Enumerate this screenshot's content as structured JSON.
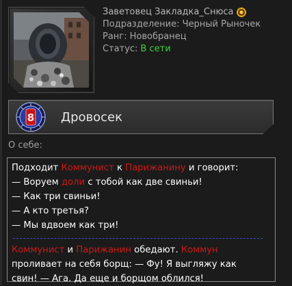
{
  "profile": {
    "name": "Заветовец Закладка_Снюса",
    "division_label": "Подразделение:",
    "division_value": "Черный Рыночек",
    "rank_label": "Ранг:",
    "rank_value": "Новобранец",
    "status_label": "Статус:",
    "status_value": "В сети",
    "status_color": "#3bd13b"
  },
  "rank_bar": {
    "title": "Дровосек",
    "emblem_number": "8"
  },
  "about": {
    "label": "О себе:",
    "joke1": {
      "l1": [
        "Подходит ",
        "Коммунист",
        " к ",
        "Парижанину",
        " и говорит:"
      ],
      "l2": [
        "— Воруем ",
        "доли",
        " с тобой как две свиньи!"
      ],
      "l3": "— Как три свиньи!",
      "l4": "— А кто третья?",
      "l5": "— Мы вдвоем как три!"
    },
    "joke2": {
      "l1": [
        " ",
        "Коммунист",
        " и ",
        "Парижанин",
        " обедают. ",
        "Коммун"
      ],
      "l2": "проливает на себя борщ: — Фу! Я выгляжу как",
      "l3": "свин! — Ага. Да еще и борщом облился!"
    }
  },
  "colors": {
    "highlight": "#d01717",
    "separator": "#3a4fd0"
  }
}
